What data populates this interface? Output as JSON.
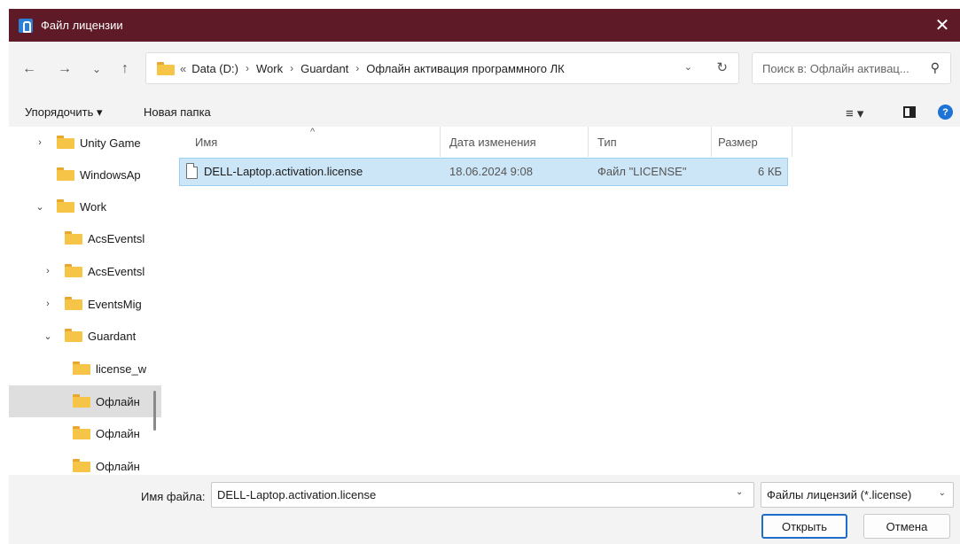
{
  "window": {
    "title": "Файл лицензии",
    "close_glyph": "✕"
  },
  "nav": {
    "back": "←",
    "forward": "→",
    "recent": "⌄",
    "up": "↑"
  },
  "address": {
    "overflow": "«",
    "crumbs": [
      "Data (D:)",
      "Work",
      "Guardant",
      "Офлайн активация программного ЛК"
    ],
    "separator": "›",
    "dropdown_glyph": "⌄",
    "refresh_glyph": "↻"
  },
  "search": {
    "placeholder": "Поиск в: Офлайн активац...",
    "icon_glyph": "⚲"
  },
  "toolbar": {
    "organize_label": "Упорядочить ▾",
    "new_folder_label": "Новая папка",
    "view_glyph": "≡ ▾",
    "help_glyph": "?"
  },
  "sidebar": {
    "items": [
      {
        "label": "Unity Game",
        "chevron": "›"
      },
      {
        "label": "WindowsAp",
        "chevron": ""
      },
      {
        "label": "Work",
        "chevron": "⌄"
      },
      {
        "label": "AcsEventsl",
        "chevron": ""
      },
      {
        "label": "AcsEventsl",
        "chevron": "›"
      },
      {
        "label": "EventsMig",
        "chevron": "›"
      },
      {
        "label": "Guardant",
        "chevron": "⌄"
      },
      {
        "label": "license_w",
        "chevron": ""
      },
      {
        "label": "Офлайн",
        "chevron": ""
      },
      {
        "label": "Офлайн",
        "chevron": ""
      },
      {
        "label": "Офлайн",
        "chevron": ""
      }
    ]
  },
  "filelist": {
    "columns": [
      "Имя",
      "Дата изменения",
      "Тип",
      "Размер"
    ],
    "sort_glyph": "^",
    "rows": [
      {
        "name": "DELL-Laptop.activation.license",
        "date": "18.06.2024 9:08",
        "type": "Файл \"LICENSE\"",
        "size": "6 КБ"
      }
    ]
  },
  "bottom": {
    "filename_label": "Имя файла:",
    "filename_value": "DELL-Laptop.activation.license",
    "dropdown_glyph": "⌄",
    "filter_value": "Файлы лицензий (*.license)",
    "open_label": "Открыть",
    "cancel_label": "Отмена"
  },
  "colors": {
    "titlebar": "#5e1a26",
    "selection": "#cde6f7",
    "selection_border": "#99d1f2",
    "folder": "#f6c446",
    "accent": "#1e6dc8"
  }
}
